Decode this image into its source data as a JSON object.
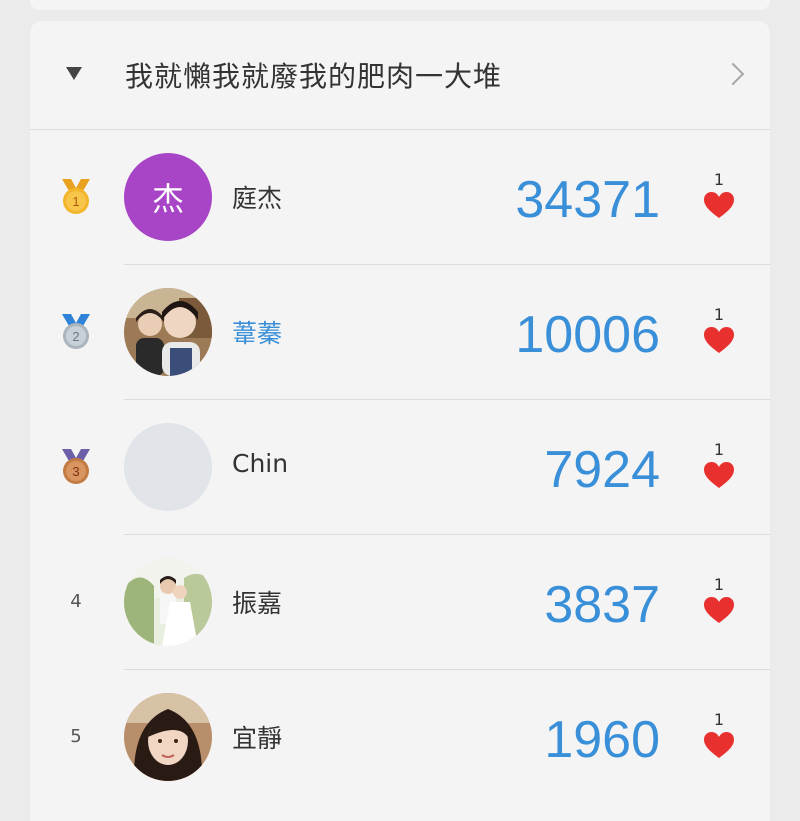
{
  "group": {
    "title": "我就懶我就廢我的肥肉一大堆"
  },
  "colors": {
    "accent": "#3a8fd9",
    "heart": "#e8312f",
    "gold": "#f3b52a",
    "silver": "#b6c0c8",
    "bronze": "#c9834a",
    "avatar_initial_bg": "#a845c6"
  },
  "leaderboard": [
    {
      "rank": "1",
      "badge": "gold-medal-icon",
      "avatar_initial": "杰",
      "name": "庭杰",
      "score": "34371",
      "likes": "1"
    },
    {
      "rank": "2",
      "badge": "silver-medal-icon",
      "avatar_photo": "two-people-photo",
      "name": "葦蓁",
      "score": "10006",
      "likes": "1"
    },
    {
      "rank": "3",
      "badge": "bronze-medal-icon",
      "avatar_photo": "empty-avatar",
      "name": "Chin",
      "score": "7924",
      "likes": "1"
    },
    {
      "rank": "4",
      "avatar_photo": "wedding-photo",
      "name": "振嘉",
      "score": "3837",
      "likes": "1"
    },
    {
      "rank": "5",
      "avatar_photo": "selfie-photo",
      "name": "宜靜",
      "score": "1960",
      "likes": "1"
    }
  ]
}
